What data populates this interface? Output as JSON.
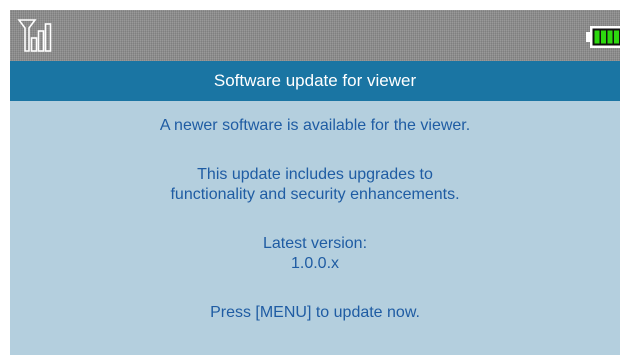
{
  "status_bar": {
    "signal_icon": "signal-strength-icon",
    "battery_icon": "battery-icon",
    "battery_color": "#2dd90f"
  },
  "dialog": {
    "title": "Software update for viewer",
    "message": "A newer software is available for the viewer.",
    "description_line1": "This update includes upgrades to",
    "description_line2": "functionality and security enhancements.",
    "version_label": "Latest version:",
    "version_value": "1.0.0.x",
    "instruction": "Press [MENU] to update now."
  },
  "colors": {
    "title_bar": "#1a75a3",
    "background": "#b4cfde",
    "text": "#1f5ca3",
    "status_bar": "#8b8b8b"
  }
}
